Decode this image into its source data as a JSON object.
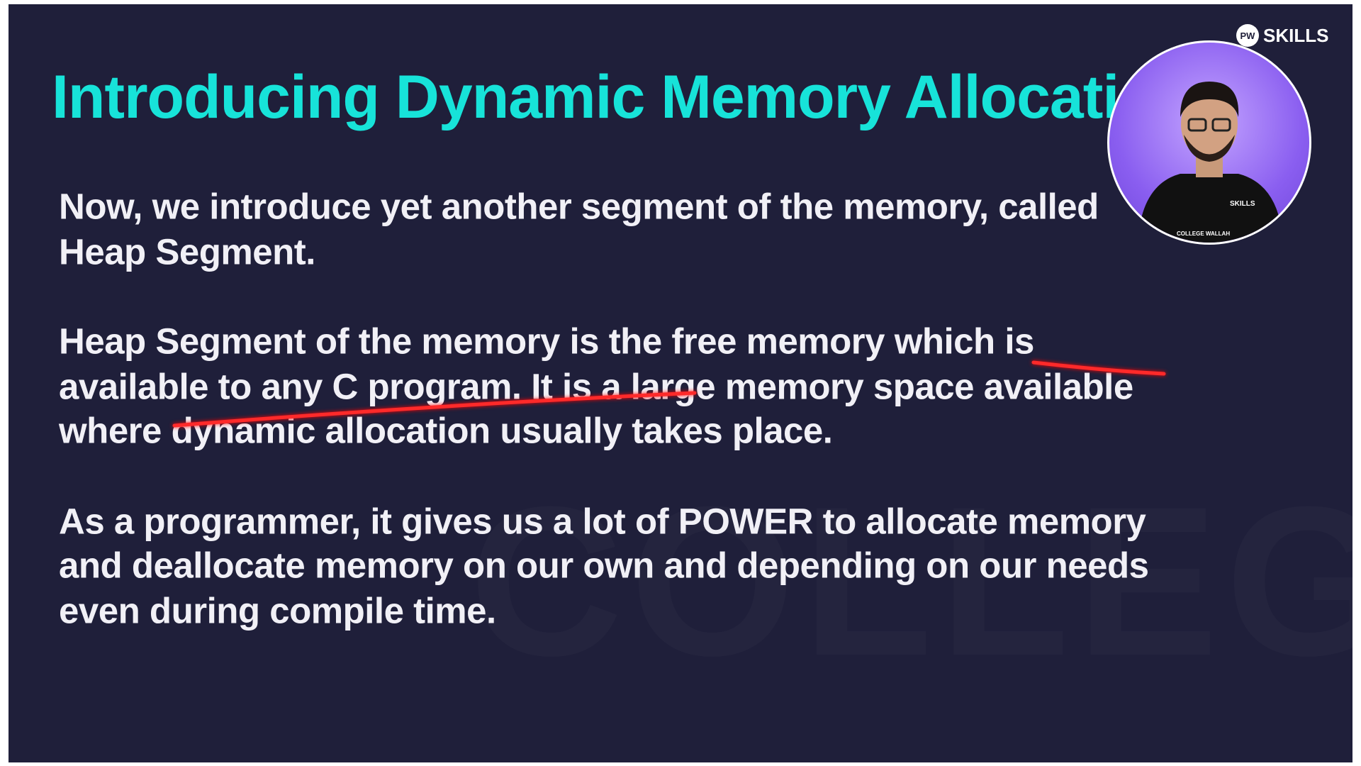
{
  "slide": {
    "title": "Introducing Dynamic Memory Allocation",
    "paragraphs": [
      [
        "Now, we introduce yet another segment of the memory, called",
        "Heap Segment."
      ],
      [
        "Heap Segment of the memory is the free memory which is",
        "available to any C program. It is a large memory space available",
        "where dynamic allocation usually takes place."
      ],
      [
        "As a programmer, it gives us a lot of POWER to allocate memory",
        "and deallocate memory on our own and depending on our needs",
        "even during compile time."
      ]
    ],
    "watermark": "COLLEGE WALLAH"
  },
  "logo": {
    "mark": "PW",
    "text": "SKILLS"
  },
  "presenter": {
    "shirt_text": "SKILLS",
    "collar_text": "COLLEGE WALLAH"
  },
  "colors": {
    "background": "#1f1f3a",
    "title": "#17e3d9",
    "body": "#f1f0f6",
    "annotation": "#ff2222"
  }
}
